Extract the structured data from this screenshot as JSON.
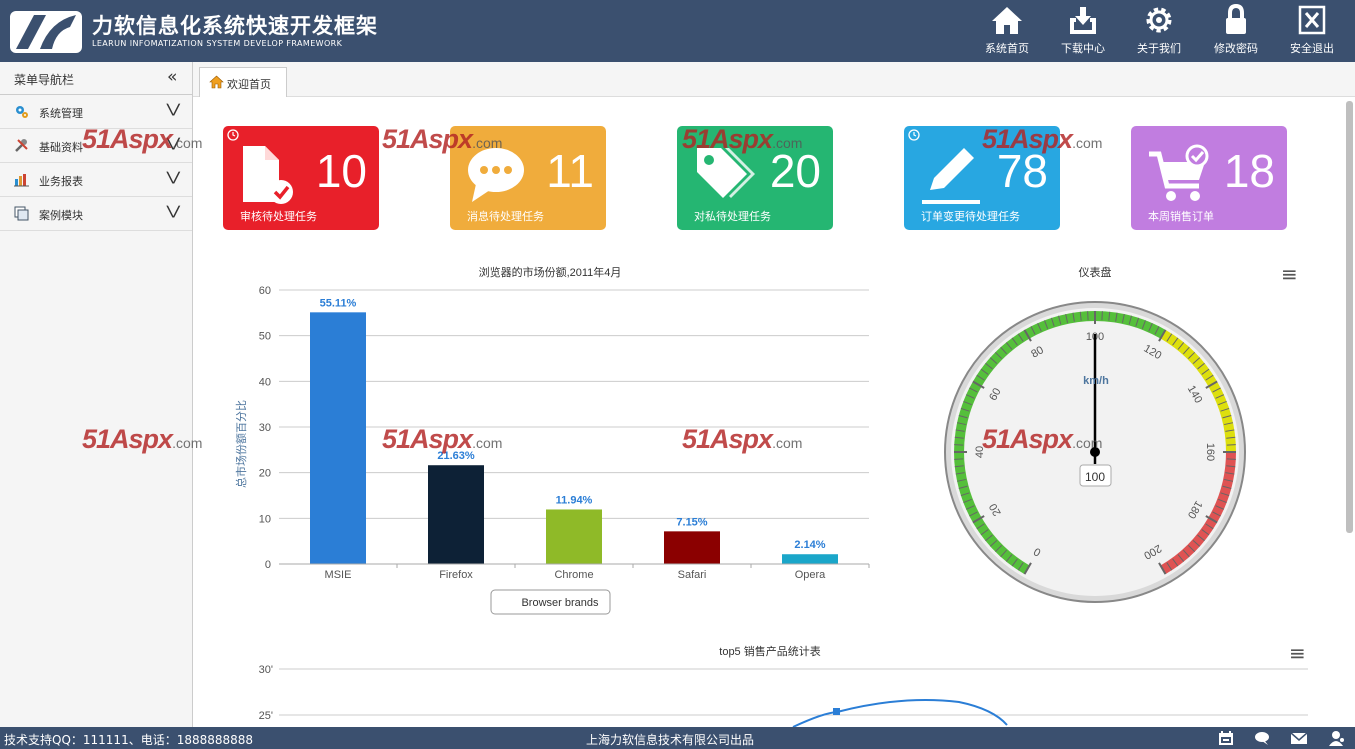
{
  "header": {
    "title": "力软信息化系统快速开发框架",
    "subtitle": "LEARUN INFOMATIZATION SYSTEM DEVELOP FRAMEWORK",
    "buttons": [
      {
        "label": "系统首页",
        "icon": "home-icon"
      },
      {
        "label": "下载中心",
        "icon": "download-icon"
      },
      {
        "label": "关于我们",
        "icon": "gear-icon"
      },
      {
        "label": "修改密码",
        "icon": "lock-icon"
      },
      {
        "label": "安全退出",
        "icon": "exit-icon"
      }
    ]
  },
  "sidebar": {
    "title": "菜单导航栏",
    "collapse_glyph": "«",
    "items": [
      {
        "label": "系统管理",
        "icon": "gears-icon"
      },
      {
        "label": "基础资料",
        "icon": "tools-icon"
      },
      {
        "label": "业务报表",
        "icon": "report-icon"
      },
      {
        "label": "案例模块",
        "icon": "module-icon"
      }
    ],
    "expand_glyph": "»"
  },
  "tabs": [
    {
      "label": "欢迎首页",
      "icon": "home-icon"
    }
  ],
  "cards": [
    {
      "value": "10",
      "label": "审核待处理任务",
      "color": "#e8202a",
      "icon": "document-check-icon",
      "clock": true
    },
    {
      "value": "11",
      "label": "消息待处理任务",
      "color": "#f0ac3c",
      "icon": "chat-icon",
      "clock": false
    },
    {
      "value": "20",
      "label": "对私待处理任务",
      "color": "#25b672",
      "icon": "tag-icon",
      "clock": false
    },
    {
      "value": "78",
      "label": "订单变更待处理任务",
      "color": "#28a7e1",
      "icon": "pencil-icon",
      "clock": true
    },
    {
      "value": "18",
      "label": "本周销售订单",
      "color": "#c17de0",
      "icon": "cart-icon",
      "clock": false
    }
  ],
  "watermark": {
    "text": "51Aspx",
    "suffix": ".com"
  },
  "chart_data": [
    {
      "type": "bar",
      "title": "浏览器的市场份额,2011年4月",
      "ylabel": "总市场份额百分比",
      "xlabel": "",
      "categories": [
        "MSIE",
        "Firefox",
        "Chrome",
        "Safari",
        "Opera"
      ],
      "values": [
        55.11,
        21.63,
        11.94,
        7.15,
        2.14
      ],
      "data_labels": [
        "55.11%",
        "21.63%",
        "11.94%",
        "7.15%",
        "2.14%"
      ],
      "colors": [
        "#2b7ed6",
        "#0d2136",
        "#8fba28",
        "#8b0000",
        "#1aa6c9"
      ],
      "ylim": [
        0,
        60
      ],
      "yticks": [
        "0",
        "10",
        "20",
        "30",
        "40",
        "50",
        "60"
      ],
      "grid": true,
      "legend": {
        "position": "bottom-center",
        "label": "Browser brands"
      }
    },
    {
      "type": "gauge",
      "title": "仪表盘",
      "unit": "km/h",
      "value": 100,
      "value_label": "100",
      "min": 0,
      "max": 200,
      "tick_labels": [
        "0",
        "20",
        "40",
        "60",
        "80",
        "100",
        "120",
        "140",
        "160",
        "180",
        "200"
      ],
      "bands": [
        {
          "from": 0,
          "to": 120,
          "color": "#55bf3b"
        },
        {
          "from": 120,
          "to": 160,
          "color": "#dddf0d"
        },
        {
          "from": 160,
          "to": 200,
          "color": "#df5353"
        }
      ]
    },
    {
      "type": "line",
      "title": "top5 销售产品统计表",
      "ytick_labels": [
        "30'",
        "25'"
      ],
      "partial": true
    }
  ],
  "chart_menu_glyph": "≡",
  "footer": {
    "left": "技术支持QQ：111111、电话：1888888888",
    "center": "上海力软信息技术有限公司出品",
    "icons": [
      "calendar-icon",
      "chat-bubble-icon",
      "mail-icon",
      "user-icon"
    ]
  }
}
